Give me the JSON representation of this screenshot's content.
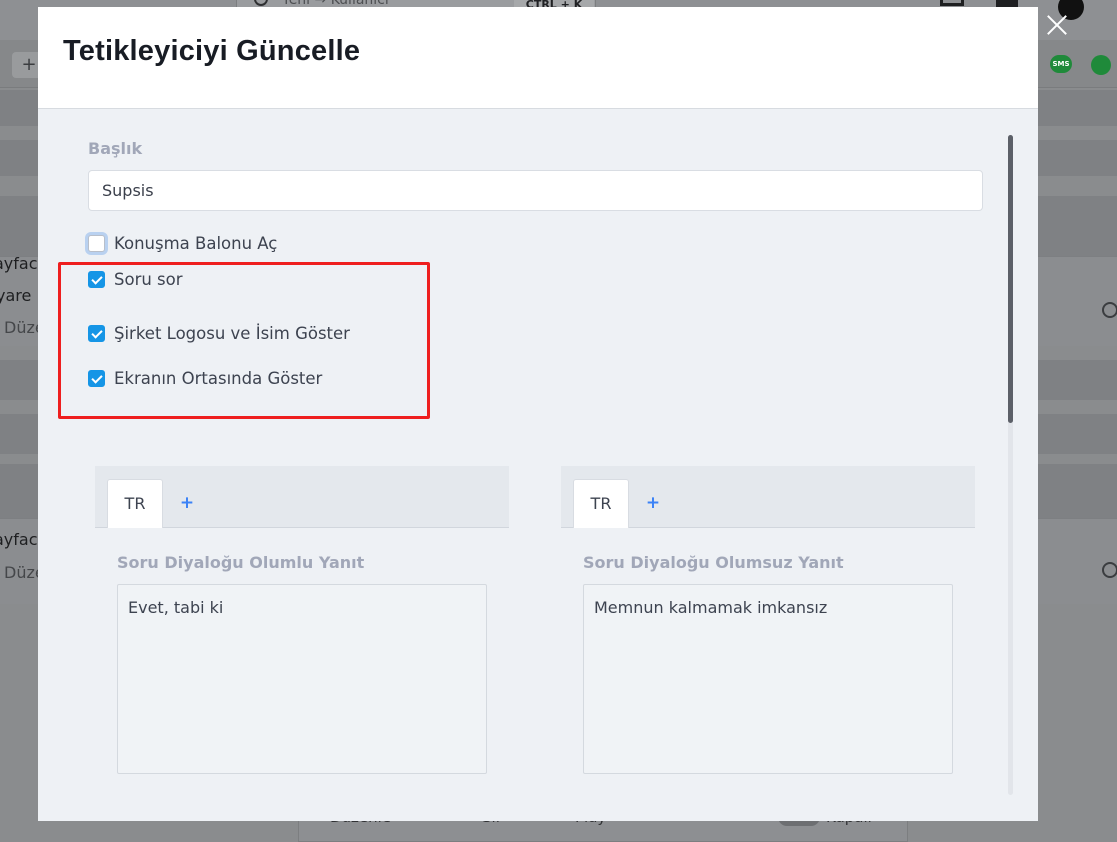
{
  "background": {
    "search_placeholder": "Yeni → Kullanıcı",
    "shortcut": "CTRL + K",
    "toolbar_plus": "+",
    "sms_badge": "SMS",
    "rows": [
      {
        "line1": "ayfac",
        "line2": "yare",
        "line3": "Düze"
      },
      {
        "line1": "ayfac",
        "line3": "Düze"
      }
    ],
    "footer": {
      "edit": "Düzenle",
      "delete": "Sil",
      "play": "Play",
      "toggle_label": "Kapalı"
    }
  },
  "modal": {
    "title": "Tetikleyiciyi Güncelle",
    "close_label": "×",
    "title_field": {
      "label": "Başlık",
      "value": "Supsis"
    },
    "checkboxes": [
      {
        "label": "Konuşma Balonu Aç",
        "checked": false
      },
      {
        "label": "Soru sor",
        "checked": true
      },
      {
        "label": "Şirket Logosu ve İsim Göster",
        "checked": true
      },
      {
        "label": "Ekranın Ortasında Göster",
        "checked": true
      }
    ],
    "panels": [
      {
        "tab": "TR",
        "add": "+",
        "label": "Soru Diyaloğu Olumlu Yanıt",
        "value": "Evet, tabi ki"
      },
      {
        "tab": "TR",
        "add": "+",
        "label": "Soru Diyaloğu Olumsuz Yanıt",
        "value": "Memnun kalmamak imkansız"
      }
    ],
    "colors": {
      "accent": "#1595e6",
      "highlight": "#ee1e1e",
      "tab_add": "#3b82f6"
    }
  }
}
